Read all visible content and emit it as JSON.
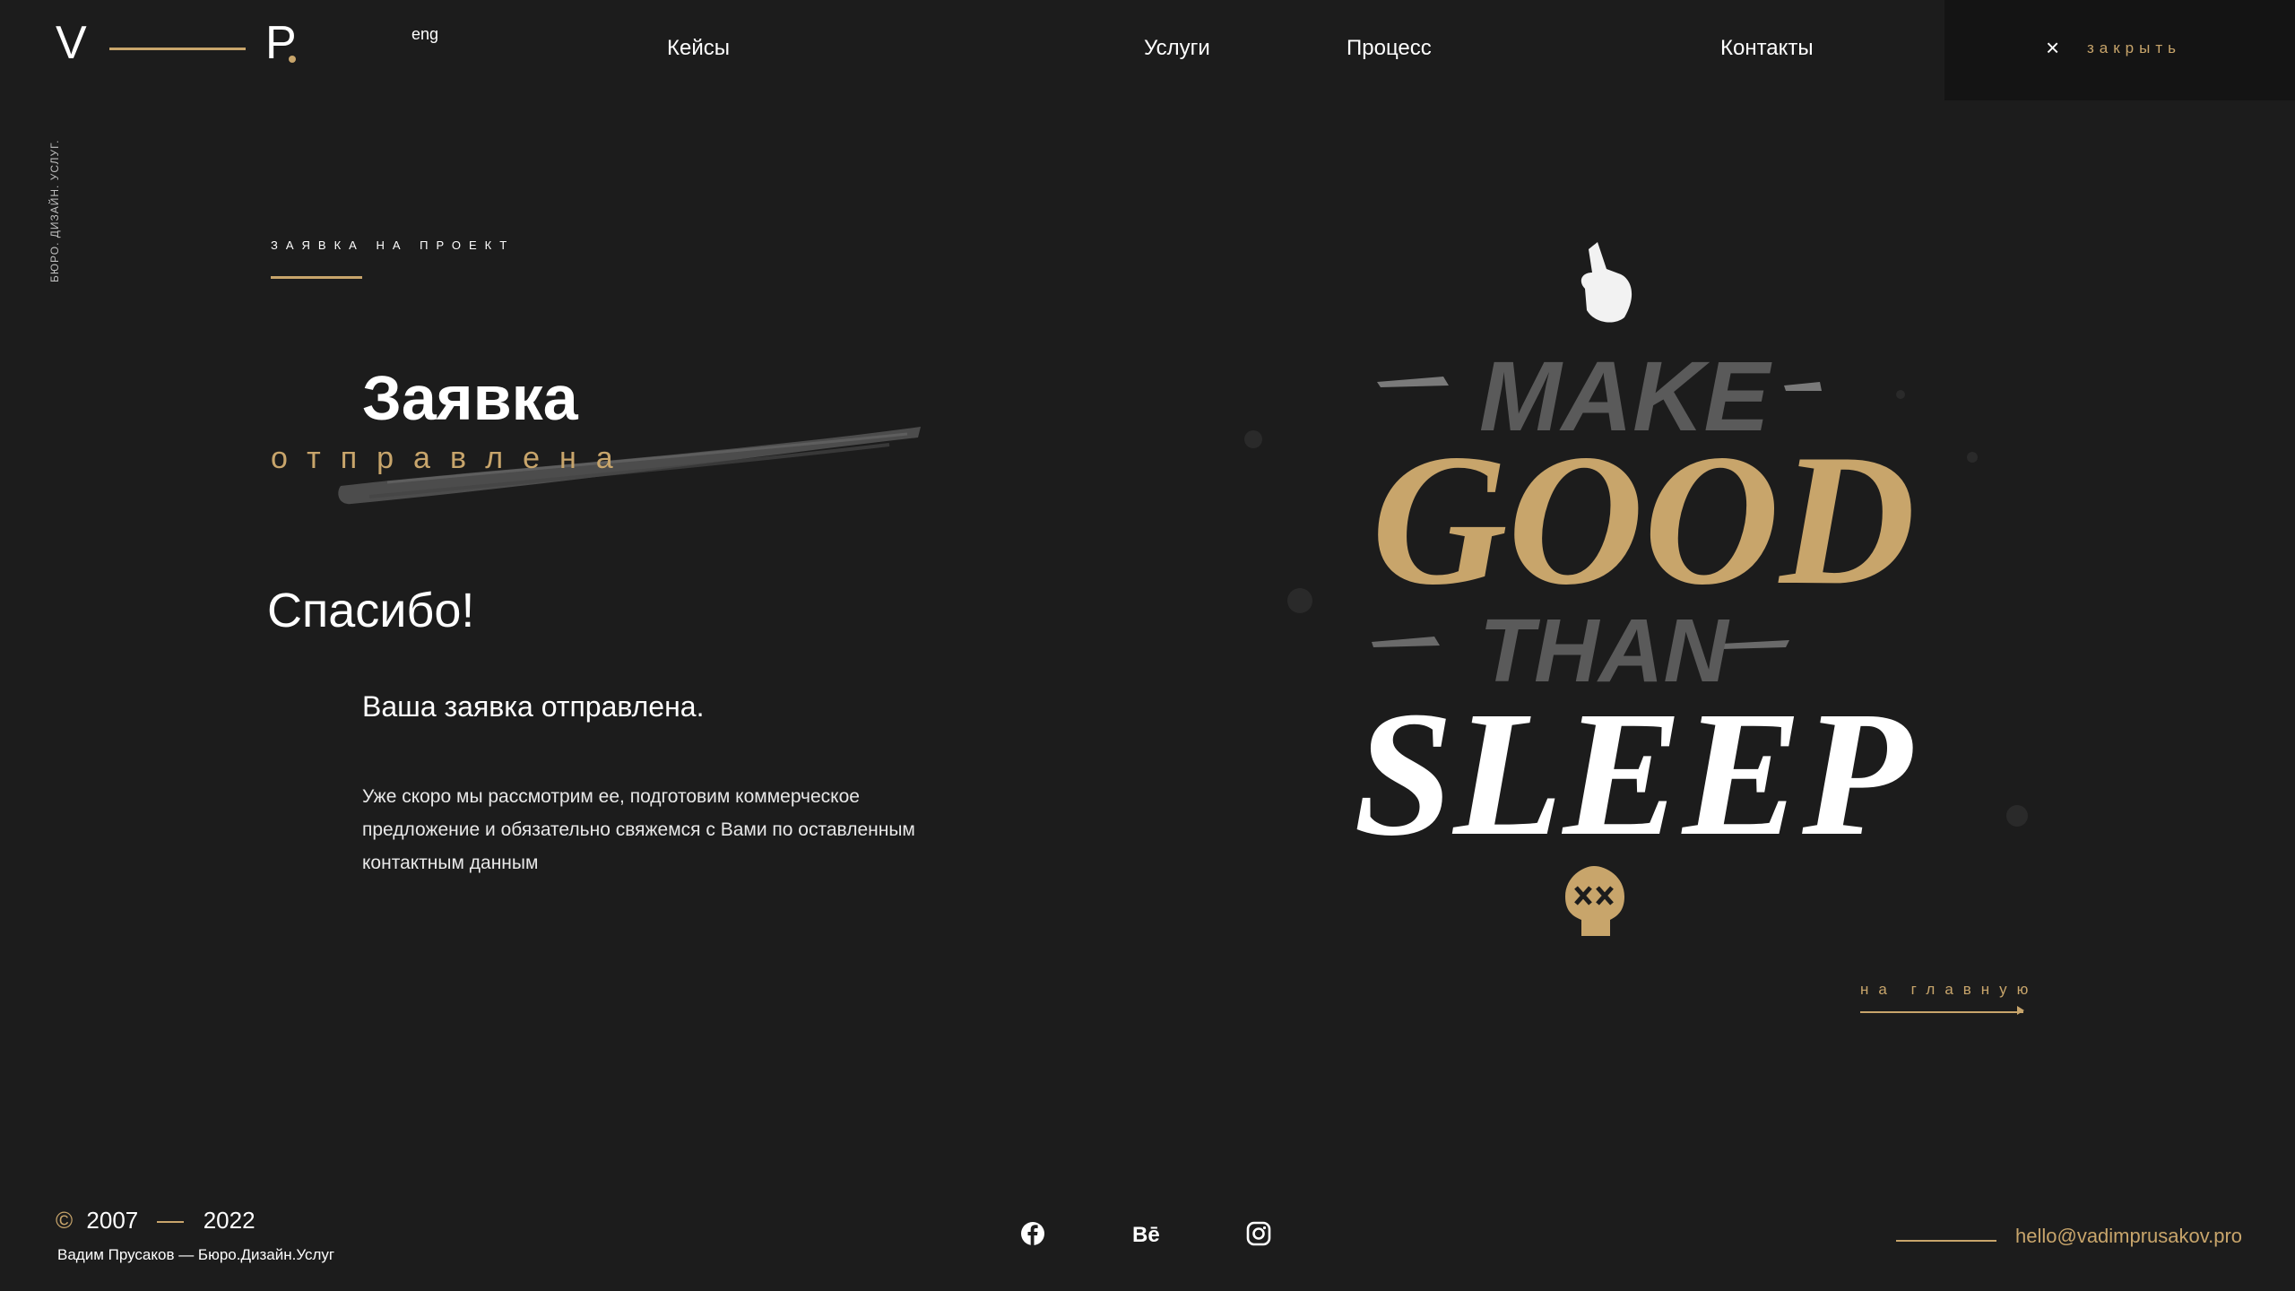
{
  "header": {
    "logo_left": "V",
    "logo_right": "P",
    "lang": "eng",
    "nav": [
      "Кейсы",
      "Услуги",
      "Процесс",
      "Контакты"
    ],
    "close_label": "закрыть",
    "close_icon": "×"
  },
  "side_text": "БЮРО. ДИЗАЙН. УСЛУГ.",
  "main": {
    "eyebrow": "ЗАЯВКА НА ПРОЕКТ",
    "title": "Заявка",
    "subtitle": "отправлена",
    "thanks": "Спасибо!",
    "sent": "Ваша заявка отправлена.",
    "paragraph": "Уже скоро мы рассмотрим ее, подготовим коммерческое предложение и обязательно свяжемся с Вами по оставленным контактным данным"
  },
  "art": {
    "line1": "MAKE",
    "line2": "GOOD",
    "line3": "THAN",
    "line4": "SLEEP"
  },
  "home_link": "на главную",
  "footer": {
    "copyright_symbol": "©",
    "year_start": "2007",
    "year_end": "2022",
    "credit": "Вадим Прусаков — Бюро.Дизайн.Услуг",
    "social": [
      "facebook-icon",
      "behance-icon",
      "instagram-icon"
    ],
    "behance_label": "Bē",
    "email": "hello@vadimprusakov.pro"
  },
  "colors": {
    "background": "#1c1c1c",
    "accent": "#c8a56b",
    "panel": "#141414",
    "text": "#ffffff"
  }
}
